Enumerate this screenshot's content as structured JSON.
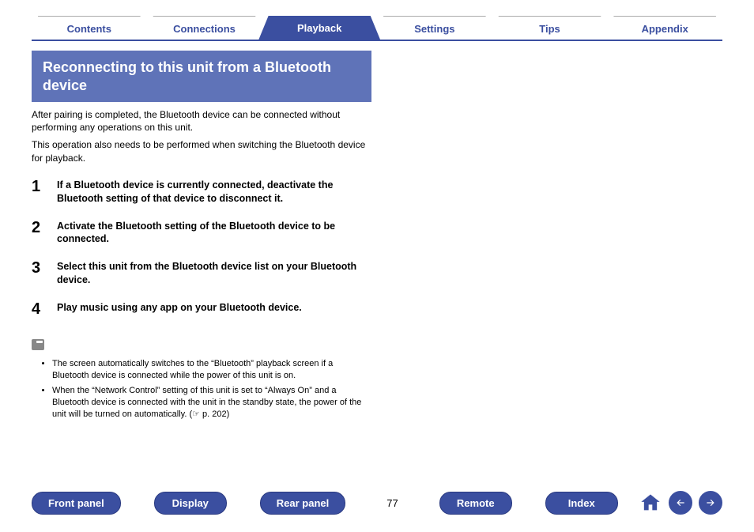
{
  "topTabs": [
    {
      "label": "Contents",
      "active": false
    },
    {
      "label": "Connections",
      "active": false
    },
    {
      "label": "Playback",
      "active": true
    },
    {
      "label": "Settings",
      "active": false
    },
    {
      "label": "Tips",
      "active": false
    },
    {
      "label": "Appendix",
      "active": false
    }
  ],
  "heading": "Reconnecting to this unit from a Bluetooth device",
  "intro1": "After pairing is completed, the Bluetooth device can be connected without performing any operations on this unit.",
  "intro2": "This operation also needs to be performed when switching the Bluetooth device for playback.",
  "steps": [
    {
      "n": "1",
      "text": "If a Bluetooth device is currently connected, deactivate the Bluetooth setting of that device to disconnect it."
    },
    {
      "n": "2",
      "text": "Activate the Bluetooth setting of the Bluetooth device to be connected."
    },
    {
      "n": "3",
      "text": "Select this unit from the Bluetooth device list on your Bluetooth device."
    },
    {
      "n": "4",
      "text": "Play music using any app on your Bluetooth device."
    }
  ],
  "notes": [
    "The screen automatically switches to the “Bluetooth” playback screen if a Bluetooth device is connected while the power of this unit is on.",
    "When the “Network Control” setting of this unit is set to “Always On” and a Bluetooth device is connected with the unit in the standby state, the power of the unit will be turned on automatically.  (☞ p. 202)"
  ],
  "footer": {
    "buttons_left": [
      "Front panel",
      "Display",
      "Rear panel"
    ],
    "page": "77",
    "buttons_right": [
      "Remote",
      "Index"
    ]
  }
}
